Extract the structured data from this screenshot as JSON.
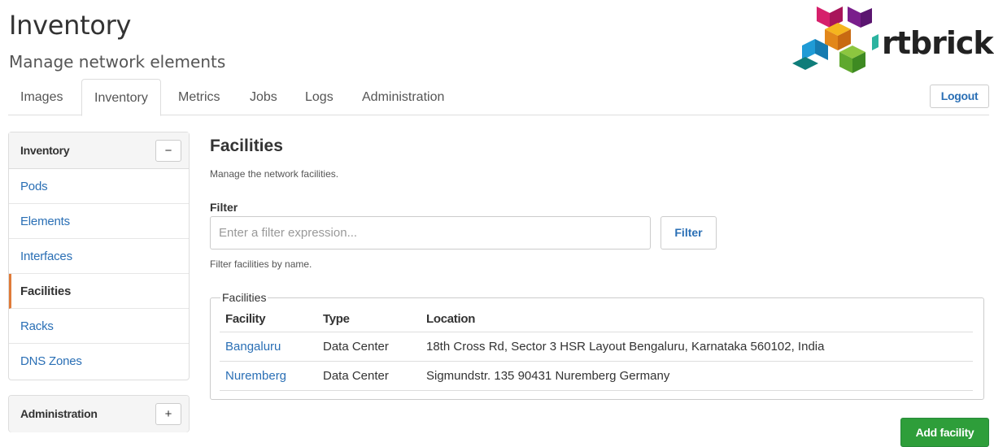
{
  "header": {
    "title": "Inventory",
    "subtitle": "Manage network elements",
    "logo_text": "rtbrick",
    "logout_label": "Logout"
  },
  "nav": {
    "tabs": [
      {
        "label": "Images",
        "active": false
      },
      {
        "label": "Inventory",
        "active": true
      },
      {
        "label": "Metrics",
        "active": false
      },
      {
        "label": "Jobs",
        "active": false
      },
      {
        "label": "Logs",
        "active": false
      },
      {
        "label": "Administration",
        "active": false
      }
    ]
  },
  "sidebar": {
    "inventory": {
      "title": "Inventory",
      "toggle": "−",
      "items": [
        {
          "label": "Pods"
        },
        {
          "label": "Elements"
        },
        {
          "label": "Interfaces"
        },
        {
          "label": "Facilities",
          "active": true
        },
        {
          "label": "Racks"
        },
        {
          "label": "DNS Zones"
        }
      ]
    },
    "administration": {
      "title": "Administration",
      "toggle": "+"
    }
  },
  "main": {
    "title": "Facilities",
    "description": "Manage the network facilities.",
    "filter": {
      "label": "Filter",
      "placeholder": "Enter a filter expression...",
      "button": "Filter",
      "help": "Filter facilities by name."
    },
    "table": {
      "legend": "Facilities",
      "columns": [
        "Facility",
        "Type",
        "Location"
      ],
      "rows": [
        [
          "Bangaluru",
          "Data Center",
          "18th Cross Rd, Sector 3 HSR Layout Bengaluru, Karnataka 560102, India"
        ],
        [
          "Nuremberg",
          "Data Center",
          "Sigmundstr. 135 90431 Nuremberg Germany"
        ]
      ]
    },
    "add_button": "Add facility"
  },
  "colors": {
    "link": "#2a6fb5",
    "active_indicator": "#e07b39",
    "primary_success": "#2e9e3a"
  }
}
